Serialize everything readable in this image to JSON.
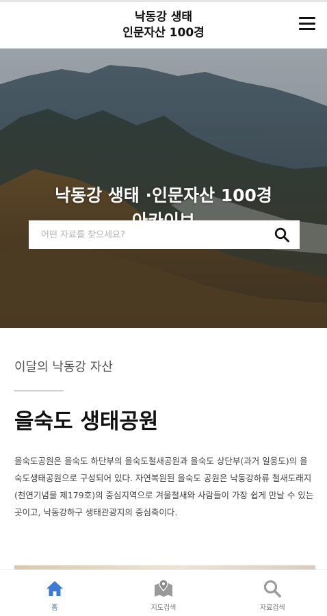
{
  "header": {
    "logo_line1": "낙동강 생태",
    "logo_line2": "인문자산 100경"
  },
  "hero": {
    "title_line1": "낙동강 생태 ·인문자산 100경",
    "title_line2": "아카이브",
    "search_placeholder": "어떤 자료를 찾으세요?"
  },
  "monthly": {
    "section_label": "이달의 낙동강 자산",
    "asset_title": "을숙도 생태공원",
    "asset_description": "을숙도공원은 을숙도 하단부의 을숙도철새공원과 을숙도 상단부(과거 일웅도)의 을숙도생태공원으로 구성되어 있다. 자연복원된 을숙도 공원은 낙동강하류 철새도래지 (천연기념물 제179호)의 중심지역으로 겨울철새와 사람들이 가장 쉽게 만날 수 있는 곳이고, 낙동강하구 생태관광지의 중심축이다."
  },
  "bottom_nav": {
    "items": [
      {
        "label": "홈",
        "icon": "home-icon",
        "active": true
      },
      {
        "label": "지도검색",
        "icon": "map-icon",
        "active": false
      },
      {
        "label": "자료검색",
        "icon": "search-icon",
        "active": false
      }
    ]
  },
  "colors": {
    "accent": "#3a7bd5",
    "inactive_icon": "#9a9a9a"
  }
}
